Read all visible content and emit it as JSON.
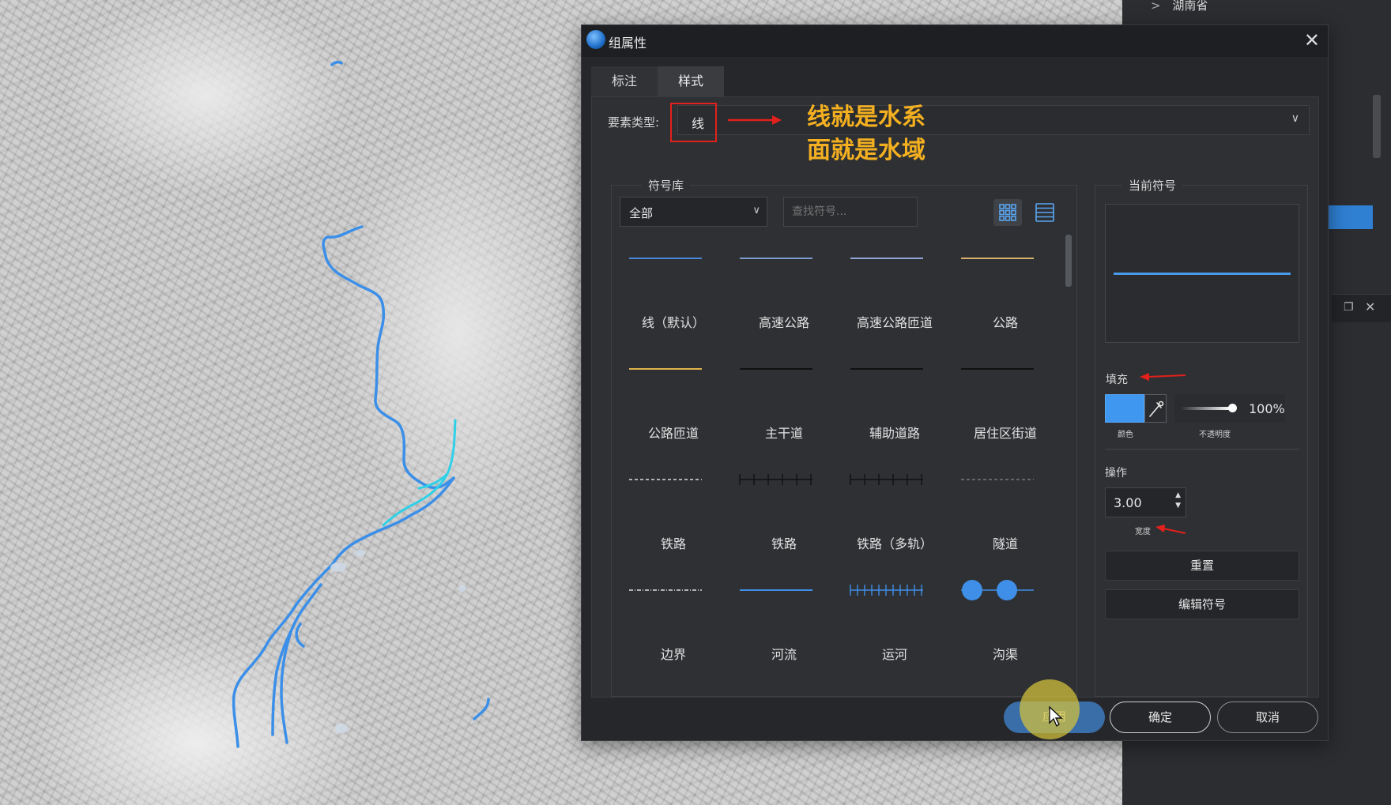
{
  "side_panel": {
    "tree_item": "湖南省"
  },
  "dialog": {
    "title": "组属性",
    "tabs": [
      "标注",
      "样式"
    ],
    "element_type": {
      "label": "要素类型:",
      "value": "线"
    },
    "annotation": {
      "line1": "线就是水系",
      "line2": "面就是水域",
      "color": "#f4b020"
    },
    "symbol_library": {
      "legend": "符号库",
      "filter_value": "全部",
      "search_placeholder": "查找符号...",
      "symbols": [
        {
          "label": "线（默认）",
          "style": "solid",
          "color": "#4a86d8"
        },
        {
          "label": "高速公路",
          "style": "solid",
          "color": "#7e9bd0"
        },
        {
          "label": "高速公路匝道",
          "style": "solid",
          "color": "#8fa6d6"
        },
        {
          "label": "公路",
          "style": "solid",
          "color": "#d7b06a"
        },
        {
          "label": "公路匝道",
          "style": "solid",
          "color": "#e0b24a"
        },
        {
          "label": "主干道",
          "style": "solid",
          "color": "#111111"
        },
        {
          "label": "辅助道路",
          "style": "solid",
          "color": "#111111"
        },
        {
          "label": "居住区街道",
          "style": "solid",
          "color": "#111111"
        },
        {
          "label": "铁路",
          "style": "dashed",
          "color": "#dddddd"
        },
        {
          "label": "铁路",
          "style": "ticks",
          "color": "#111111"
        },
        {
          "label": "铁路（多轨）",
          "style": "ticks",
          "color": "#111111"
        },
        {
          "label": "隧道",
          "style": "dashed",
          "color": "#777777"
        },
        {
          "label": "边界",
          "style": "dashdot",
          "color": "#dddddd"
        },
        {
          "label": "河流",
          "style": "solid",
          "color": "#3f8ee8"
        },
        {
          "label": "运河",
          "style": "ticks",
          "color": "#3f8ee8"
        },
        {
          "label": "沟渠",
          "style": "dots",
          "color": "#3f8ee8"
        }
      ]
    },
    "current_symbol": {
      "legend": "当前符号",
      "fill_label": "填充",
      "color_caption": "颜色",
      "fill_color": "#3f97ef",
      "opacity_value": "100%",
      "opacity_caption": "不透明度",
      "operation_label": "操作",
      "width_value": "3.00",
      "width_caption": "宽度",
      "reset_button": "重置",
      "edit_button": "编辑符号"
    },
    "footer": {
      "apply": "应用",
      "ok": "确定",
      "cancel": "取消"
    }
  }
}
